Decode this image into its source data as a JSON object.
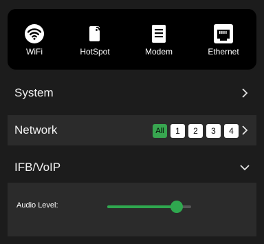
{
  "connections": [
    {
      "label": "WiFi",
      "icon": "wifi-icon"
    },
    {
      "label": "HotSpot",
      "icon": "hotspot-icon"
    },
    {
      "label": "Modem",
      "icon": "modem-icon"
    },
    {
      "label": "Ethernet",
      "icon": "ethernet-icon"
    }
  ],
  "system": {
    "title": "System"
  },
  "network": {
    "title": "Network",
    "tabs": [
      "All",
      "1",
      "2",
      "3",
      "4"
    ],
    "active_tab": "All"
  },
  "ifb": {
    "title": "IFB/VoIP"
  },
  "audio": {
    "label": "Audio Level:",
    "level": 0.83
  },
  "colors": {
    "accent": "#38a650",
    "panel": "#2b2b2b",
    "background": "#1c1c1c"
  }
}
